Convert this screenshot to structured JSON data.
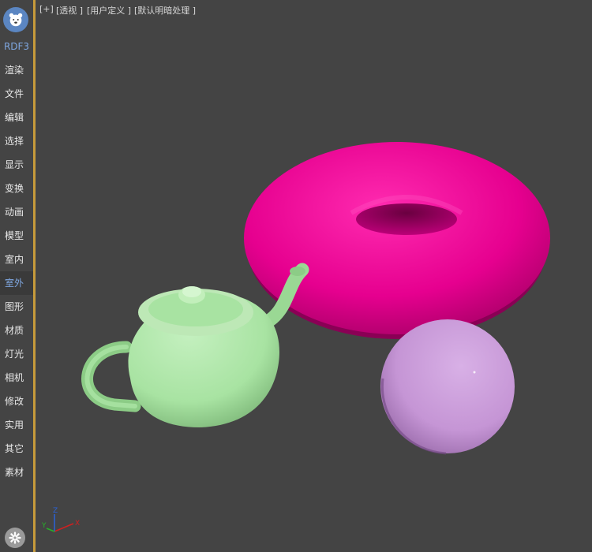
{
  "sidebar": {
    "plugin_label": "RDF3",
    "items": [
      {
        "label": "渲染",
        "active": false
      },
      {
        "label": "文件",
        "active": false
      },
      {
        "label": "编辑",
        "active": false
      },
      {
        "label": "选择",
        "active": false
      },
      {
        "label": "显示",
        "active": false
      },
      {
        "label": "变换",
        "active": false
      },
      {
        "label": "动画",
        "active": false
      },
      {
        "label": "模型",
        "active": false
      },
      {
        "label": "室内",
        "active": false
      },
      {
        "label": "室外",
        "active": true
      },
      {
        "label": "图形",
        "active": false
      },
      {
        "label": "材质",
        "active": false
      },
      {
        "label": "灯光",
        "active": false
      },
      {
        "label": "相机",
        "active": false
      },
      {
        "label": "修改",
        "active": false
      },
      {
        "label": "实用",
        "active": false
      },
      {
        "label": "其它",
        "active": false
      },
      {
        "label": "素材",
        "active": false
      }
    ]
  },
  "viewport": {
    "labels": {
      "plus": "[+]",
      "view": "[透视 ]",
      "user": "[用户定义 ]",
      "shading": "[默认明暗处理 ]"
    },
    "axis": {
      "x": "X",
      "y": "Y",
      "z": "Z"
    },
    "objects": [
      {
        "name": "torus",
        "color": "#e6008f"
      },
      {
        "name": "teapot",
        "color": "#a8e3a2"
      },
      {
        "name": "sphere",
        "color": "#c595d5"
      }
    ]
  },
  "colors": {
    "background": "#444444",
    "sidebar_edge": "#c79b3b",
    "accent": "#7fa7e0"
  }
}
